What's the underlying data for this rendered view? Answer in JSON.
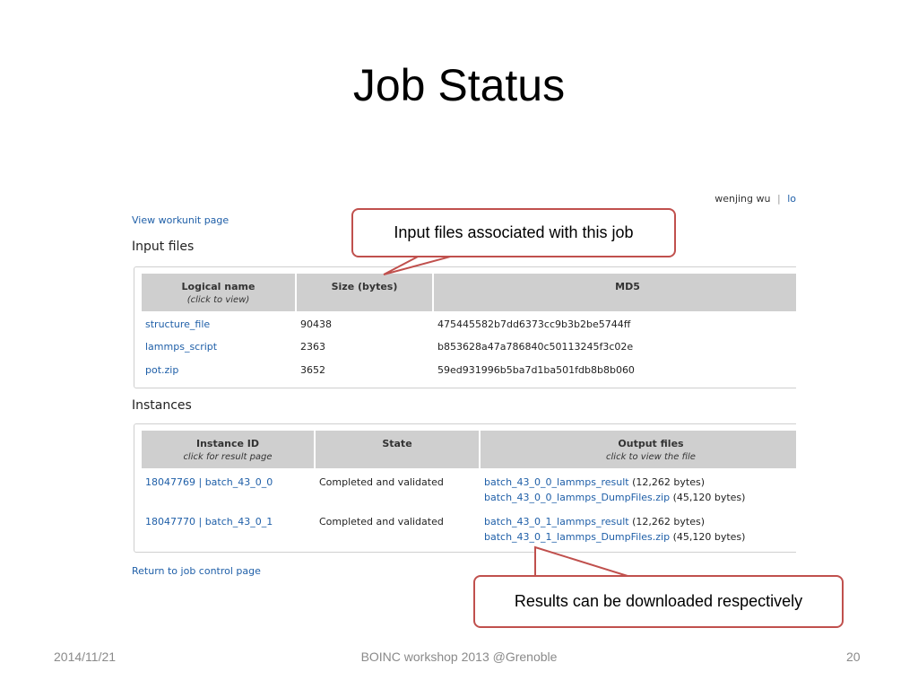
{
  "slide": {
    "title": "Job Status",
    "footer_date": "2014/11/21",
    "footer_center": "BOINC workshop 2013 @Grenoble",
    "page_number": "20"
  },
  "screenshot": {
    "user_name": "wenjing wu",
    "separator": "|",
    "user_link_partial": "lo",
    "view_workunit": "View workunit page",
    "input_files_heading": "Input files",
    "input_headers": {
      "logical_name": "Logical name",
      "logical_name_hint": "(click to view)",
      "size": "Size (bytes)",
      "md5": "MD5"
    },
    "input_files": [
      {
        "name": "structure_file",
        "size": "90438",
        "md5": "475445582b7dd6373cc9b3b2be5744ff"
      },
      {
        "name": "lammps_script",
        "size": "2363",
        "md5": "b853628a47a786840c50113245f3c02e"
      },
      {
        "name": "pot.zip",
        "size": "3652",
        "md5": "59ed931996b5ba7d1ba501fdb8b8b060"
      }
    ],
    "instances_heading": "Instances",
    "instance_headers": {
      "id": "Instance ID",
      "id_hint": "click for result page",
      "state": "State",
      "output": "Output files",
      "output_hint": "click to view the file"
    },
    "instances": [
      {
        "id": "18047769 | batch_43_0_0",
        "state": "Completed and validated",
        "file1": "batch_43_0_0_lammps_result",
        "file1_size": "(12,262 bytes)",
        "file2": "batch_43_0_0_lammps_DumpFiles.zip",
        "file2_size": "(45,120 bytes)"
      },
      {
        "id": "18047770 | batch_43_0_1",
        "state": "Completed and validated",
        "file1": "batch_43_0_1_lammps_result",
        "file1_size": "(12,262 bytes)",
        "file2": "batch_43_0_1_lammps_DumpFiles.zip",
        "file2_size": "(45,120 bytes)"
      }
    ],
    "return_link": "Return to job control page"
  },
  "callouts": {
    "input": "Input files associated with this job",
    "results": "Results can be downloaded respectively",
    "border_color": "#c0504d"
  },
  "colors": {
    "link": "#1f5fa8",
    "table_header_bg": "#cfcfcf"
  }
}
